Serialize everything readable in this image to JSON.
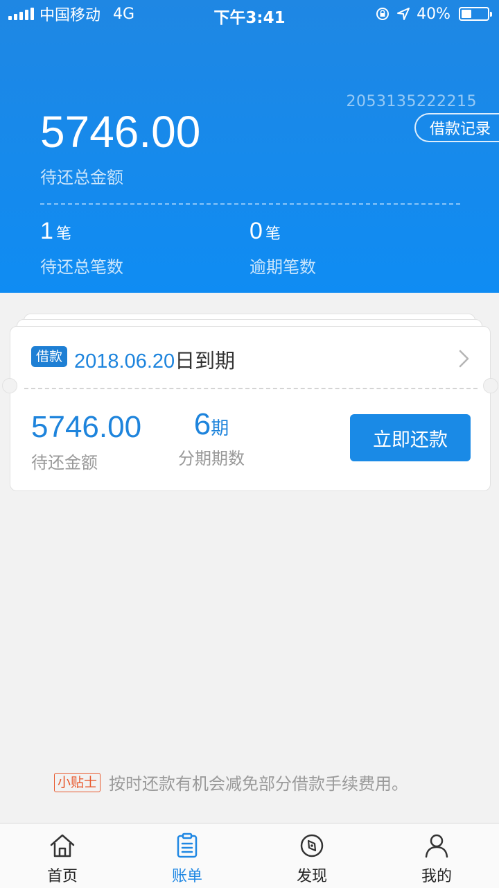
{
  "status_bar": {
    "carrier": "中国移动",
    "network": "4G",
    "time": "下午3:41",
    "battery": "40%",
    "battery_level": 0.4
  },
  "summary": {
    "account_number": "2053135222215",
    "record_button": "借款记录",
    "total_amount": "5746.00",
    "total_label": "待还总金额",
    "count_value": "1",
    "count_unit": "笔",
    "count_label": "待还总笔数",
    "overdue_value": "0",
    "overdue_unit": "笔",
    "overdue_label": "逾期笔数"
  },
  "loan_card": {
    "tag": "借款",
    "due_date": "2018.06.20",
    "due_suffix": "日到期",
    "amount_value": "5746.00",
    "amount_label": "待还金额",
    "period_value": "6",
    "period_unit": "期",
    "period_label": "分期期数",
    "repay_button": "立即还款"
  },
  "tip": {
    "badge": "小贴士",
    "text": "按时还款有机会减免部分借款手续费用。"
  },
  "tab_bar": {
    "tabs": [
      {
        "label": "首页",
        "icon": "home-icon"
      },
      {
        "label": "账单",
        "icon": "bill-icon"
      },
      {
        "label": "发现",
        "icon": "compass-icon"
      },
      {
        "label": "我的",
        "icon": "person-icon"
      }
    ],
    "active_index": 1
  },
  "colors": {
    "primary": "#1a8ae6",
    "tip_accent": "#e8582c"
  }
}
